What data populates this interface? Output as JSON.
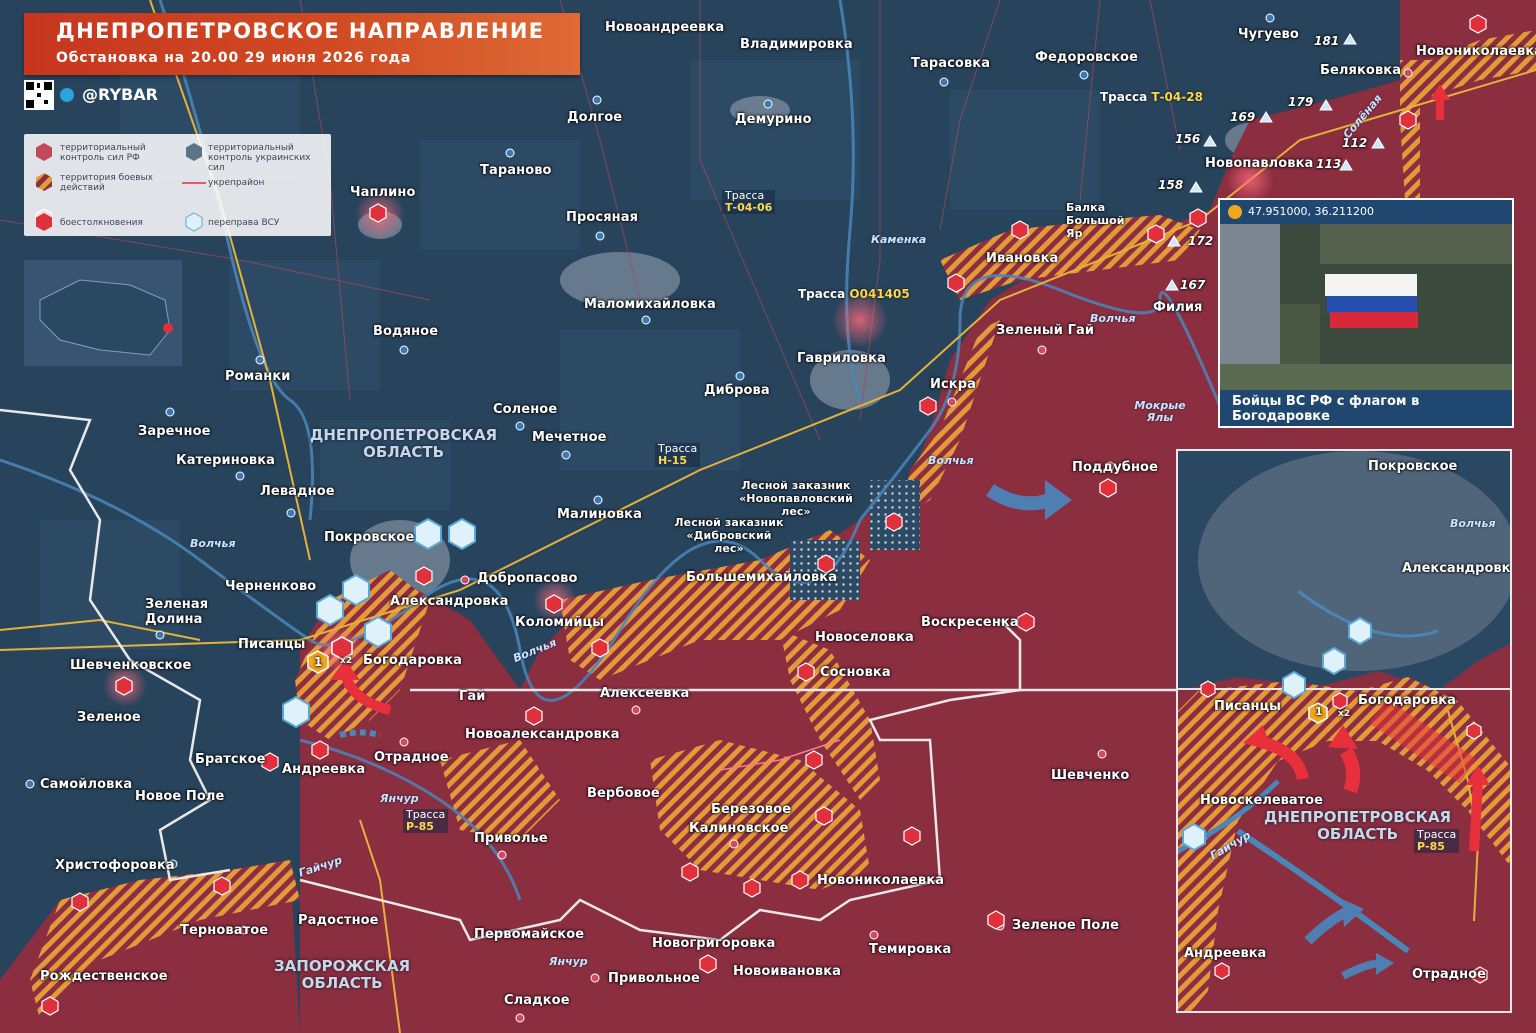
{
  "header": {
    "title": "ДНЕПРОПЕТРОВСКОЕ НАПРАВЛЕНИЕ",
    "subtitle": "Обстановка на 20.00 29 июня 2026 года",
    "handle": "@RYBAR"
  },
  "legend": {
    "ru_control": "территориальный контроль сил РФ",
    "ua_control": "территориальный контроль украинских сил",
    "combat_zone": "территория боевых действий",
    "fortification": "укрепрайон",
    "clash": "боестолкновения",
    "crossing": "переправа ВСУ"
  },
  "colors": {
    "ru_zone": "#8a2e40",
    "ua_zone": "#2b4863",
    "combat": "#e8a23a",
    "accent": "#d84a24",
    "road": "#e4b23a"
  },
  "settlements": [
    {
      "name": "Новоандреевка"
    },
    {
      "name": "Владимировка"
    },
    {
      "name": "Тарасовка"
    },
    {
      "name": "Федоровское"
    },
    {
      "name": "Чугуево"
    },
    {
      "name": "Новониколаевка"
    },
    {
      "name": "Беляковка"
    },
    {
      "name": "Долгое"
    },
    {
      "name": "Демурино"
    },
    {
      "name": "Тараново"
    },
    {
      "name": "Чаплино"
    },
    {
      "name": "Новопавловка"
    },
    {
      "name": "Просяная"
    },
    {
      "name": "Ивановка"
    },
    {
      "name": "Маломихайловка"
    },
    {
      "name": "Водяное"
    },
    {
      "name": "Гавриловка"
    },
    {
      "name": "Зеленый Гай"
    },
    {
      "name": "Филия"
    },
    {
      "name": "Романки"
    },
    {
      "name": "Искра"
    },
    {
      "name": "Диброва"
    },
    {
      "name": "Соленое"
    },
    {
      "name": "Заречное"
    },
    {
      "name": "Мечетное"
    },
    {
      "name": "Катериновка"
    },
    {
      "name": "Поддубное"
    },
    {
      "name": "Левадное"
    },
    {
      "name": "Малиновка"
    },
    {
      "name": "Покровское"
    },
    {
      "name": "Черненково"
    },
    {
      "name": "Добропасово"
    },
    {
      "name": "Большемихайловка"
    },
    {
      "name": "Александровка"
    },
    {
      "name": "Зеленая Долина"
    },
    {
      "name": "Коломийцы"
    },
    {
      "name": "Воскресенка"
    },
    {
      "name": "Писанцы"
    },
    {
      "name": "Новоселовка"
    },
    {
      "name": "Богодаровка"
    },
    {
      "name": "Шевченковское"
    },
    {
      "name": "Сосновка"
    },
    {
      "name": "Гай"
    },
    {
      "name": "Алексеевка"
    },
    {
      "name": "Зеленое"
    },
    {
      "name": "Новоалександровка"
    },
    {
      "name": "Братское"
    },
    {
      "name": "Отрадное"
    },
    {
      "name": "Андреевка"
    },
    {
      "name": "Шевченко"
    },
    {
      "name": "Самойловка"
    },
    {
      "name": "Вербовое"
    },
    {
      "name": "Новое Поле"
    },
    {
      "name": "Березовое"
    },
    {
      "name": "Калиновское"
    },
    {
      "name": "Приволье"
    },
    {
      "name": "Христофоровка"
    },
    {
      "name": "Новониколаевка"
    },
    {
      "name": "Радостное"
    },
    {
      "name": "Терноватое"
    },
    {
      "name": "Зеленое Поле"
    },
    {
      "name": "Первомайское"
    },
    {
      "name": "Темировка"
    },
    {
      "name": "Новогригоровка"
    },
    {
      "name": "Рождественское"
    },
    {
      "name": "Новоивановка"
    },
    {
      "name": "Привольное"
    },
    {
      "name": "Сладкое"
    }
  ],
  "rivers": [
    "Волчья",
    "Волчья",
    "Волчья",
    "Волчья",
    "Каменка",
    "Мокрые Ялы",
    "Солёная",
    "Янчур",
    "Янчур",
    "Гайчур"
  ],
  "regions": [
    {
      "line1": "ДНЕПРОПЕТРОВСКАЯ",
      "line2": "ОБЛАСТЬ"
    },
    {
      "line1": "ЗАПОРОЖСКАЯ",
      "line2": "ОБЛАСТЬ"
    }
  ],
  "highways": [
    {
      "label": "Трасса",
      "code": "Т-04-28"
    },
    {
      "label": "Трасса",
      "code": "Т-04-06"
    },
    {
      "label": "Трасса",
      "code": "О041405"
    },
    {
      "label": "Трасса",
      "code": "Н-15"
    },
    {
      "label": "Трасса",
      "code": "Р-85"
    }
  ],
  "heights": [
    "181",
    "179",
    "169",
    "156",
    "112",
    "158",
    "113",
    "172",
    "167"
  ],
  "nature": {
    "balka": "Балка Большой Яр",
    "forest1": "Лесной заказник «Новопавловский лес»",
    "forest2": "Лесной заказник «Дибровский лес»"
  },
  "badges": {
    "number": "1",
    "x2": "x2"
  },
  "photo": {
    "coords": "47.951000, 36.211200",
    "caption": "Бойцы ВС РФ с флагом в Богодаровке"
  },
  "inset": {
    "labels": [
      "Покровское",
      "Волчья",
      "Александровка",
      "Писанцы",
      "Богодаровка",
      "Новоскелеватое",
      "Андреевка",
      "Отрадное",
      "Гайчур"
    ],
    "region": {
      "line1": "ДНЕПРОПЕТРОВСКАЯ",
      "line2": "ОБЛАСТЬ"
    },
    "highway": {
      "label": "Трасса",
      "code": "Р-85"
    }
  }
}
